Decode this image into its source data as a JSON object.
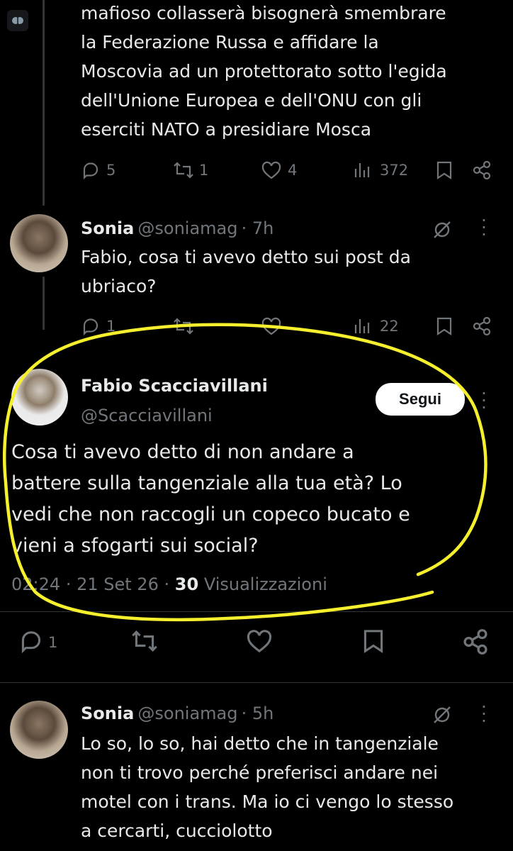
{
  "tweet1": {
    "text": "mafioso collasserà bisognerà smembrare\nla Federazione Russa e affidare la\nMoscovia ad un protettorato sotto l'egida\ndell'Unione Europea e dell'ONU con gli\neserciti NATO a presidiare Mosca",
    "replies": "5",
    "retweets": "1",
    "likes": "4",
    "views": "372"
  },
  "reply1": {
    "name": "Sonia",
    "handle": "@soniamag",
    "time": "· 7h",
    "text": "Fabio, cosa ti avevo detto sui post da\nubriaco?",
    "replies": "1",
    "views": "22"
  },
  "main": {
    "name": "Fabio Scacciavillani",
    "handle": "@Scacciavillani",
    "follow_label": "Segui",
    "text": "Cosa ti avevo detto di non andare a\nbattere sulla tangenziale alla tua età? Lo\nvedi che non raccogli un copeco bucato e\nvieni a sfogarti sui social?",
    "time": "02:24",
    "date": "21 Set 26",
    "separator": "·",
    "views_count": "30",
    "views_label": "Visualizzazioni",
    "replies": "1"
  },
  "reply2": {
    "name": "Sonia",
    "handle": "@soniamag",
    "time": "· 5h",
    "text": "Lo so, lo so, hai detto che in tangenziale\nnon ti trovo perché preferisci andare nei\nmotel con i trans. Ma io ci vengo lo stesso\na cercarti, cucciolotto"
  },
  "colors": {
    "background": "#000000",
    "text": "#e7e9ea",
    "secondary": "#71767b",
    "highlight": "#f5ef2e"
  }
}
